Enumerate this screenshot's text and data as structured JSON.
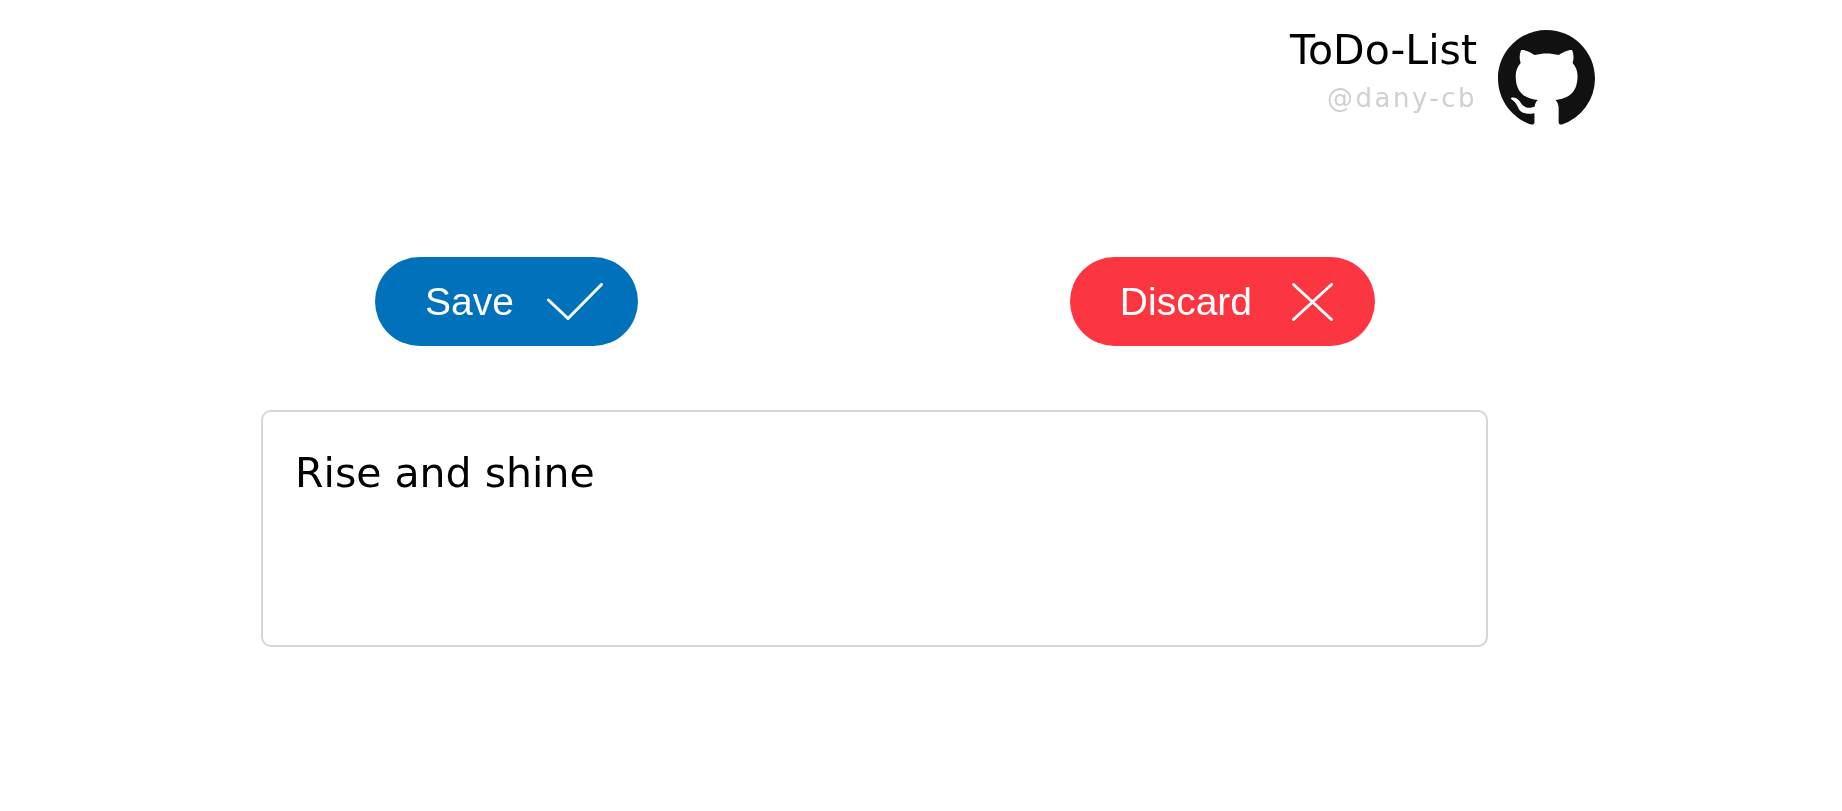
{
  "header": {
    "title": "ToDo-List",
    "username": "@dany-cb"
  },
  "actions": [
    {
      "kind": "save",
      "label": "Save"
    },
    {
      "kind": "discard",
      "label": "Discard"
    }
  ],
  "note": {
    "value": "Rise and shine"
  }
}
